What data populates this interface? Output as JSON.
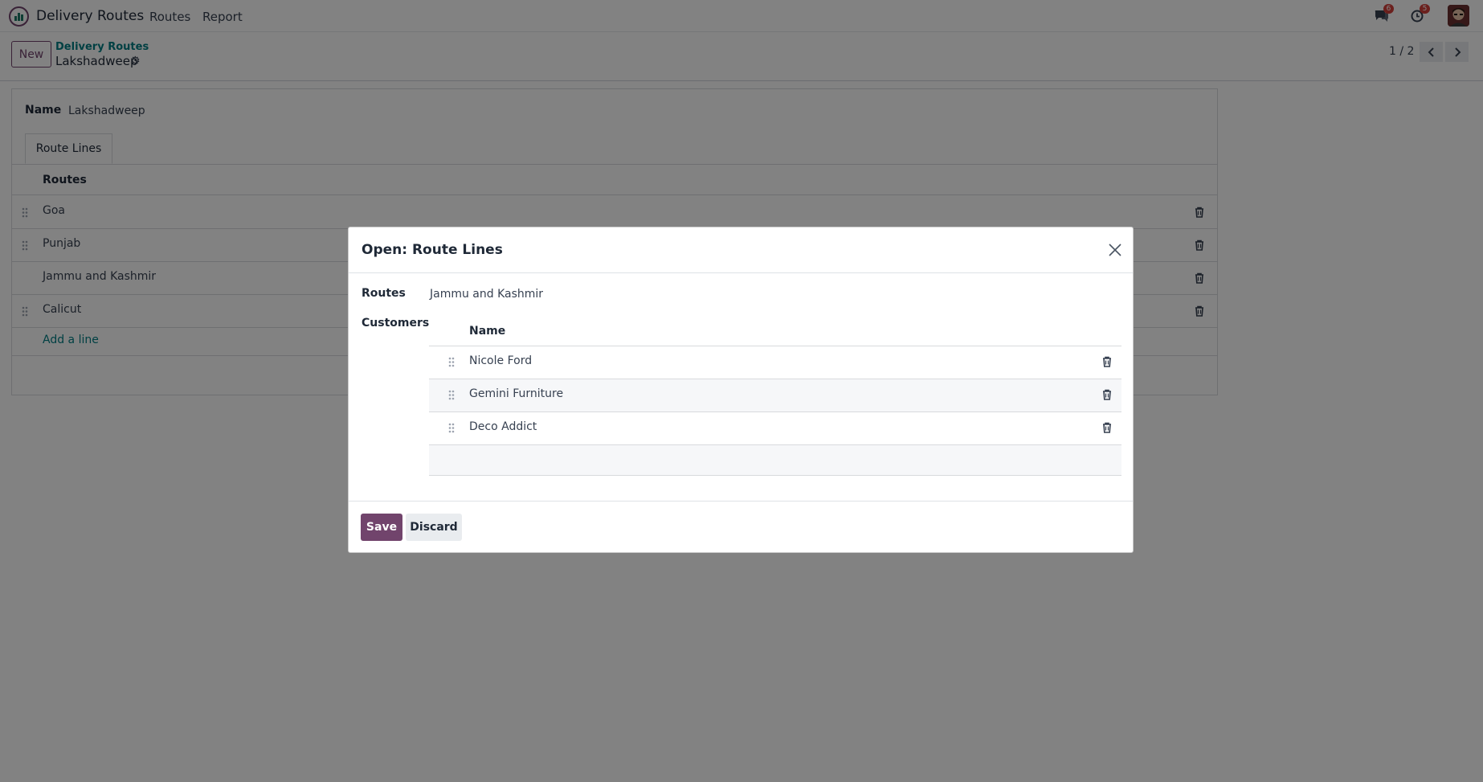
{
  "navbar": {
    "app_name": "Delivery Routes",
    "menus": [
      "Routes",
      "Report"
    ],
    "messages_badge": "6",
    "activities_badge": "5"
  },
  "control_panel": {
    "new_label": "New",
    "breadcrumb_parent": "Delivery Routes",
    "breadcrumb_current": "Lakshadweep",
    "pager": "1 / 2"
  },
  "form": {
    "name_label": "Name",
    "name_value": "Lakshadweep",
    "tab_label": "Route Lines",
    "routes_header": "Routes",
    "routes": [
      "Goa",
      "Punjab",
      "Jammu and Kashmir",
      "Calicut"
    ],
    "add_line": "Add a line"
  },
  "modal": {
    "title": "Open: Route Lines",
    "routes_label": "Routes",
    "routes_value": "Jammu and Kashmir",
    "customers_label": "Customers",
    "name_header": "Name",
    "customers": [
      "Nicole Ford",
      "Gemini Furniture",
      "Deco Addict"
    ],
    "save_label": "Save",
    "discard_label": "Discard"
  },
  "colors": {
    "brand": "#71446c",
    "link": "#017e84",
    "badge": "#d23f3a"
  }
}
